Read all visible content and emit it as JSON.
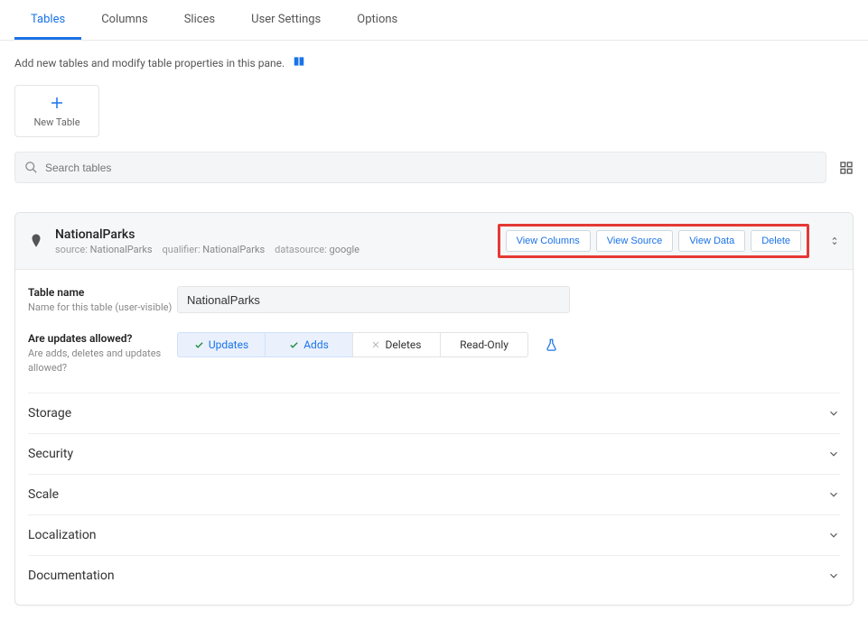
{
  "tabs": [
    {
      "label": "Tables",
      "active": true
    },
    {
      "label": "Columns",
      "active": false
    },
    {
      "label": "Slices",
      "active": false
    },
    {
      "label": "User Settings",
      "active": false
    },
    {
      "label": "Options",
      "active": false
    }
  ],
  "description": "Add new tables and modify table properties in this pane.",
  "new_table_label": "New Table",
  "search": {
    "placeholder": "Search tables"
  },
  "table": {
    "title": "NationalParks",
    "meta": {
      "source_label": "source:",
      "source_value": "NationalParks",
      "qualifier_label": "qualifier:",
      "qualifier_value": "NationalParks",
      "datasource_label": "datasource:",
      "datasource_value": "google"
    },
    "actions": {
      "view_columns": "View Columns",
      "view_source": "View Source",
      "view_data": "View Data",
      "delete": "Delete"
    }
  },
  "form": {
    "table_name": {
      "label": "Table name",
      "sublabel": "Name for this table (user-visible)",
      "value": "NationalParks"
    },
    "updates": {
      "label": "Are updates allowed?",
      "sublabel": "Are adds, deletes and updates allowed?",
      "options": {
        "updates": "Updates",
        "adds": "Adds",
        "deletes": "Deletes",
        "readonly": "Read-Only"
      }
    }
  },
  "accordion": [
    "Storage",
    "Security",
    "Scale",
    "Localization",
    "Documentation"
  ]
}
